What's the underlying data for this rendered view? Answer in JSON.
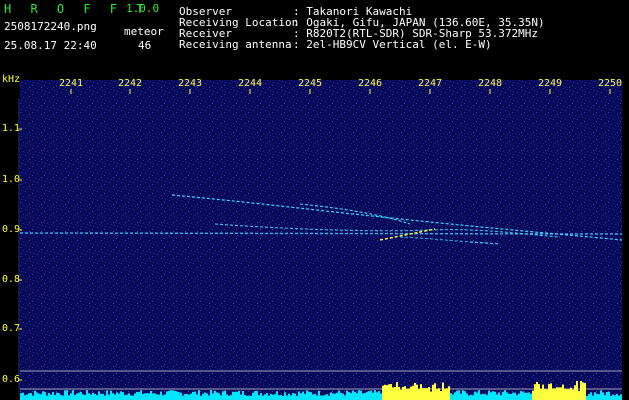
{
  "app": {
    "name": "H R O F F T",
    "version": "1.0.0"
  },
  "file": {
    "name": "2508172240.png",
    "datetime": "25.08.17 22:40"
  },
  "meteor": {
    "label": "meteor",
    "count": "46"
  },
  "info": {
    "labels": [
      "Observer",
      "Receiving Location",
      "Receiver",
      "Receiving antenna"
    ],
    "values": [
      ": Takanori Kawachi",
      ": Ogaki, Gifu, JAPAN (136.60E, 35.35N)",
      ": R820T2(RTL-SDR) SDR-Sharp 53.372MHz",
      ": 2el-HB9CV Vertical (el. E-W)"
    ]
  },
  "spectrogram": {
    "y_unit": "kHz",
    "y_ticks": [
      "1.1",
      "1.0",
      "0.9",
      "0.8",
      "0.7",
      "0.6"
    ],
    "time_ticks": [
      "2241",
      "2242",
      "2243",
      "2244",
      "2245",
      "2246",
      "2247",
      "2248",
      "2249",
      "2250"
    ],
    "colors": {
      "background": "#0a0a5a",
      "noise": "#1e2ab4",
      "echo": "#39d7ff",
      "signal_hot": "#ffff40",
      "bar": "#00e6ff"
    }
  }
}
